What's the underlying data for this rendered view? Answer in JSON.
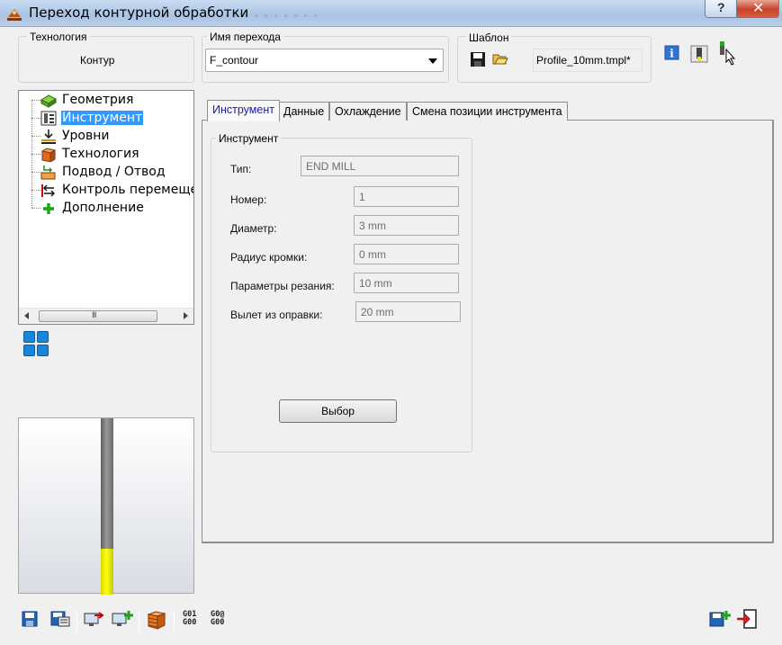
{
  "window": {
    "title": "Переход контурной обработки",
    "help_label": "?",
    "close_label": "✕"
  },
  "technology": {
    "group_label": "Технология",
    "value": "Контур"
  },
  "operation_name": {
    "group_label": "Имя перехода",
    "value": "F_contour"
  },
  "template": {
    "group_label": "Шаблон",
    "value": "Profile_10mm.tmpl*"
  },
  "tree": {
    "items": [
      {
        "label": "Геометрия",
        "icon": "geometry-icon"
      },
      {
        "label": "Инструмент",
        "icon": "tool-icon",
        "selected": true
      },
      {
        "label": "Уровни",
        "icon": "levels-icon"
      },
      {
        "label": "Технология",
        "icon": "technology-icon"
      },
      {
        "label": "Подвод / Отвод",
        "icon": "approach-retract-icon"
      },
      {
        "label": "Контроль перемещений",
        "icon": "motion-control-icon"
      },
      {
        "label": "Дополнение",
        "icon": "add-icon"
      }
    ],
    "scroll_grip": "III"
  },
  "tabs": [
    {
      "label": "Инструмент",
      "active": true
    },
    {
      "label": "Данные"
    },
    {
      "label": "Охлаждение"
    },
    {
      "label": "Смена позиции инструмента"
    }
  ],
  "tool_group": {
    "title": "Инструмент",
    "fields": {
      "type": {
        "label": "Тип:",
        "value": "END MILL"
      },
      "number": {
        "label": "Номер:",
        "value": "1"
      },
      "diameter": {
        "label": "Диаметр:",
        "value": "3 mm"
      },
      "corner": {
        "label": "Радиус кромки:",
        "value": "0 mm"
      },
      "cutting": {
        "label": "Параметры резания:",
        "value": "10 mm"
      },
      "overhang": {
        "label": "Вылет из оправки:",
        "value": "20 mm"
      }
    },
    "select_button": "Выбор"
  },
  "bottom_toolbar": {
    "gcode1": [
      "G01",
      "G00"
    ],
    "gcode2": [
      "G0@",
      "G00"
    ]
  },
  "colors": {
    "selection": "#3399ff",
    "active_tab_text": "#1a1aa8",
    "tool_shank": "#808080",
    "tool_flute": "#ffff00"
  }
}
